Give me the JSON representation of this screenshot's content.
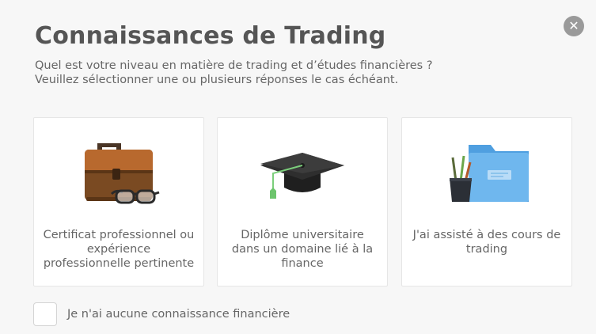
{
  "dialog": {
    "title": "Connaissances de Trading",
    "subtitle_line1": "Quel est votre niveau en matière de trading et d’études financières ?",
    "subtitle_line2": "Veuillez sélectionner une ou plusieurs réponses le cas échéant.",
    "close_glyph": "✕"
  },
  "options": [
    {
      "label": "Certificat professionnel ou expérience professionnelle pertinente",
      "icon": "briefcase-icon"
    },
    {
      "label": "Diplôme universitaire dans un domaine lié à la finance",
      "icon": "graduation-cap-icon"
    },
    {
      "label": "J'ai assisté à des cours de trading",
      "icon": "folder-icon"
    }
  ],
  "no_knowledge": {
    "label": "Je n'ai aucune connaissance financière",
    "checked": false
  },
  "colors": {
    "background": "#f7f7f7",
    "title": "#555555",
    "text": "#666666",
    "close_button": "#9a9a9a"
  }
}
